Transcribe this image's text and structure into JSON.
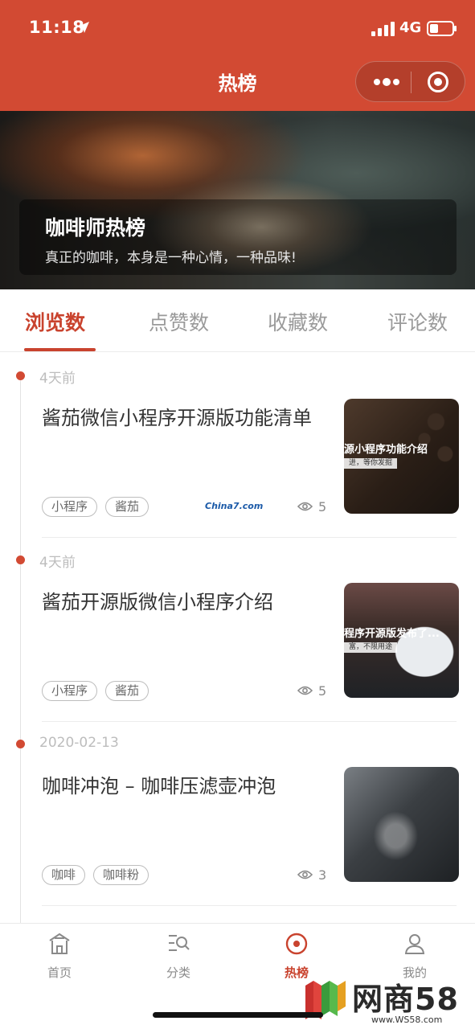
{
  "status_bar": {
    "time": "11:18",
    "network": "4G"
  },
  "nav": {
    "title": "热榜"
  },
  "banner": {
    "title": "咖啡师热榜",
    "subtitle": "真正的咖啡，本身是一种心情，一种品味!"
  },
  "tabs": [
    {
      "label": "浏览数",
      "active": true
    },
    {
      "label": "点赞数",
      "active": false
    },
    {
      "label": "收藏数",
      "active": false
    },
    {
      "label": "评论数",
      "active": false
    }
  ],
  "articles": [
    {
      "date": "4天前",
      "title": "酱茄微信小程序开源版功能清单",
      "tags": [
        "小程序",
        "酱茄"
      ],
      "views": "5",
      "thumb_caption": "源小程序功能介绍",
      "thumb_strip": "进，等你发掘",
      "inline_mark": "China7.com"
    },
    {
      "date": "4天前",
      "title": "酱茄开源版微信小程序介绍",
      "tags": [
        "小程序",
        "酱茄"
      ],
      "views": "5",
      "thumb_caption": "程序开源版发布了...",
      "thumb_strip": "富，不限用途"
    },
    {
      "date": "2020-02-13",
      "title": "咖啡冲泡 – 咖啡压滤壶冲泡",
      "tags": [
        "咖啡",
        "咖啡粉"
      ],
      "views": "3"
    }
  ],
  "tabbar": [
    {
      "label": "首页",
      "icon": "home-icon",
      "active": false
    },
    {
      "label": "分类",
      "icon": "category-search-icon",
      "active": false
    },
    {
      "label": "热榜",
      "icon": "hot-target-icon",
      "active": true
    },
    {
      "label": "我的",
      "icon": "user-icon",
      "active": false
    }
  ],
  "watermark": {
    "name": "网商58",
    "url": "www.WS58.com"
  },
  "colors": {
    "brand": "#d24a33",
    "accent": "#c9432e"
  }
}
